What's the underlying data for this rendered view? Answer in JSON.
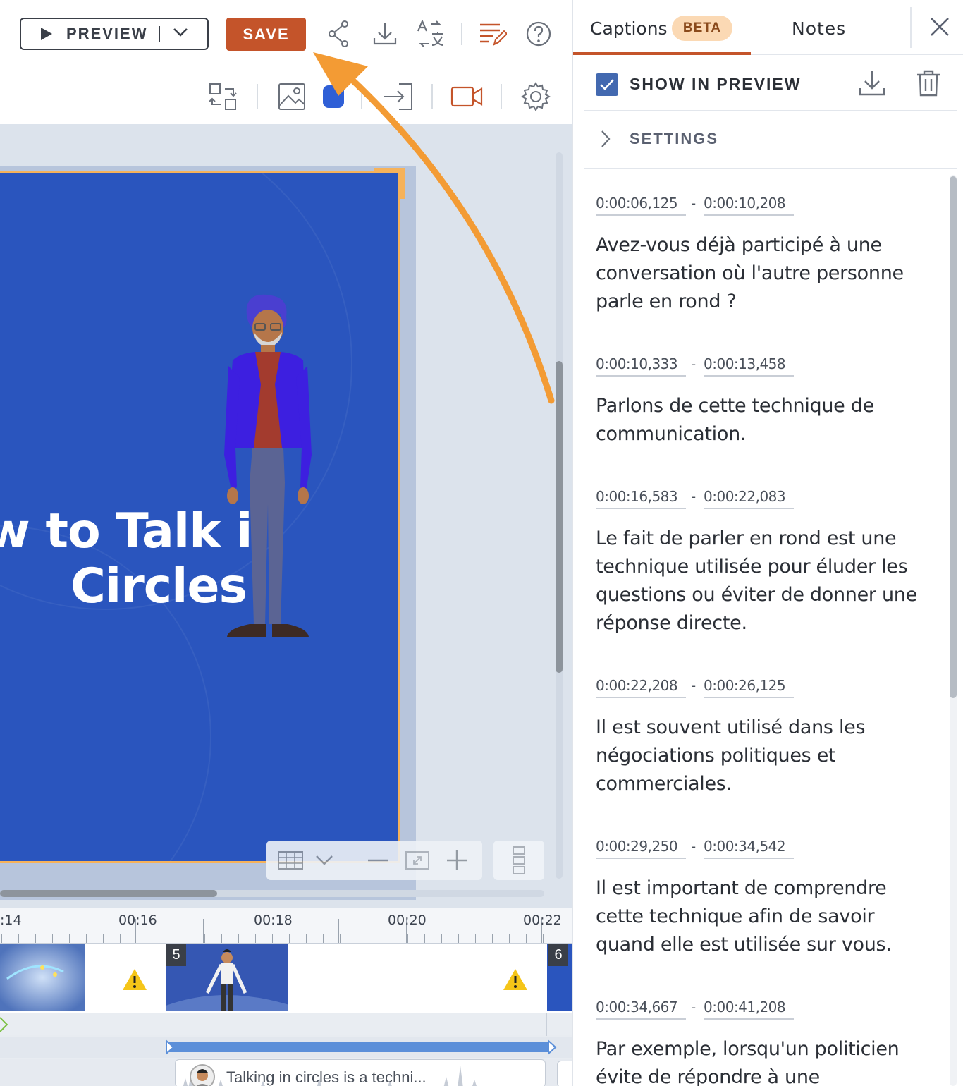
{
  "toolbar": {
    "preview_label": "PREVIEW",
    "save_label": "SAVE"
  },
  "slide": {
    "title_line1": "w to Talk i",
    "title_line2": "Circles"
  },
  "timeline": {
    "ticks": [
      ":14",
      "00:16",
      "00:18",
      "00:20",
      "00:22"
    ],
    "clips": [
      {
        "number": "5"
      },
      {
        "number": "6"
      }
    ],
    "caption_clip_text": "Talking in circles is a techni..."
  },
  "panel": {
    "tabs": {
      "captions": "Captions",
      "beta_badge": "BETA",
      "notes": "Notes"
    },
    "show_in_preview": "SHOW IN PREVIEW",
    "settings": "SETTINGS",
    "captions": [
      {
        "start": "0:00:06,125",
        "end": "0:00:10,208",
        "text": "Avez-vous déjà participé à une conversation où l'autre personne parle en rond ?"
      },
      {
        "start": "0:00:10,333",
        "end": "0:00:13,458",
        "text": "Parlons de cette technique de communication."
      },
      {
        "start": "0:00:16,583",
        "end": "0:00:22,083",
        "text": "Le fait de parler en rond est une technique utilisée pour éluder les questions ou éviter de donner une réponse directe."
      },
      {
        "start": "0:00:22,208",
        "end": "0:00:26,125",
        "text": "Il est souvent utilisé dans les négociations politiques et commerciales."
      },
      {
        "start": "0:00:29,250",
        "end": "0:00:34,542",
        "text": "Il est important de comprendre cette technique afin de savoir quand elle est utilisée sur vous."
      },
      {
        "start": "0:00:34,667",
        "end": "0:00:41,208",
        "text": "Par exemple, lorsqu'un politicien évite de répondre à une"
      }
    ]
  },
  "colors": {
    "accent": "#c4542a",
    "slide_bg": "#2a55be",
    "selection": "#f6b25a",
    "arrow": "#f39b34",
    "checkbox": "#4369b0"
  },
  "icons": [
    "play-icon",
    "chevron-down-icon",
    "share-icon",
    "download-icon",
    "translate-icon",
    "captions-edit-icon",
    "help-icon",
    "swap-icon",
    "image-icon",
    "color-icon",
    "enter-icon",
    "camera-icon",
    "gear-icon",
    "grid-icon",
    "zoom-out-icon",
    "fit-icon",
    "zoom-in-icon",
    "layout-icon",
    "warning-icon",
    "close-icon",
    "trash-icon",
    "chevron-right-icon",
    "checkmark-icon"
  ]
}
